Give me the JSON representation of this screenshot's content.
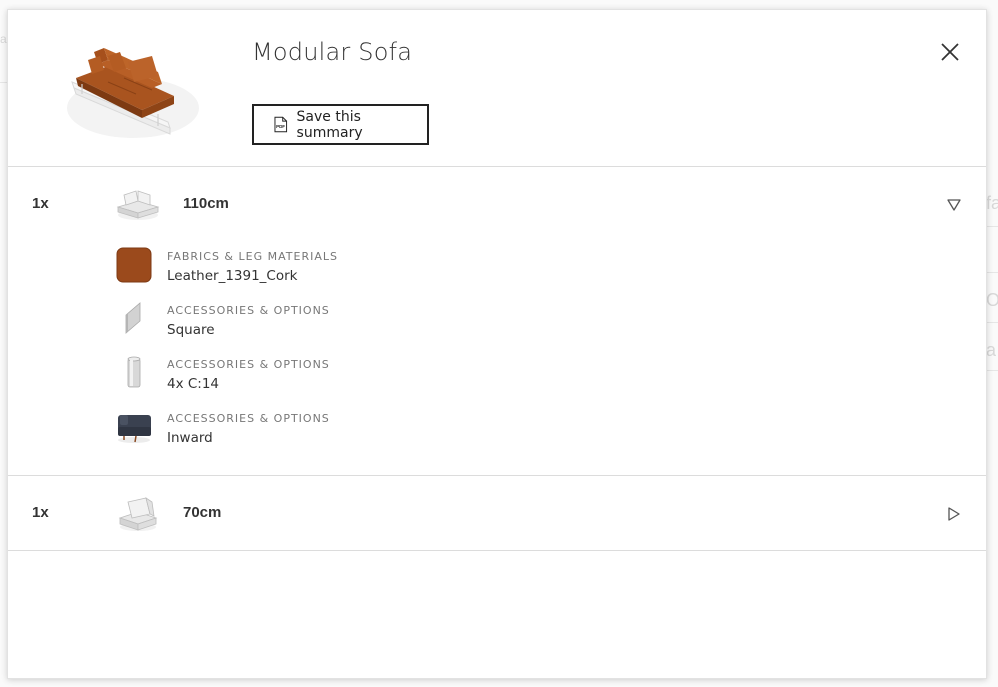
{
  "summary": {
    "title": "Modular Sofa",
    "save_label": "Save this summary",
    "pdf_icon_text": "PDF"
  },
  "background_fragments": [
    "a",
    "fa",
    "Op",
    "a"
  ],
  "items": [
    {
      "qty": "1x",
      "size": "110cm",
      "expanded": true,
      "details": [
        {
          "category": "FABRICS & LEG MATERIALS",
          "value": "Leather_1391_Cork",
          "icon": "leather-swatch-icon"
        },
        {
          "category": "ACCESSORIES & OPTIONS",
          "value": "Square",
          "icon": "square-panel-icon"
        },
        {
          "category": "ACCESSORIES & OPTIONS",
          "value": "4x C:14",
          "icon": "cylinder-leg-icon"
        },
        {
          "category": "ACCESSORIES & OPTIONS",
          "value": "Inward",
          "icon": "armrest-icon"
        }
      ]
    },
    {
      "qty": "1x",
      "size": "70cm",
      "expanded": false,
      "details": []
    }
  ],
  "colors": {
    "leather": "#9b4a1c",
    "border": "#dcdcdc",
    "text": "#333333"
  }
}
